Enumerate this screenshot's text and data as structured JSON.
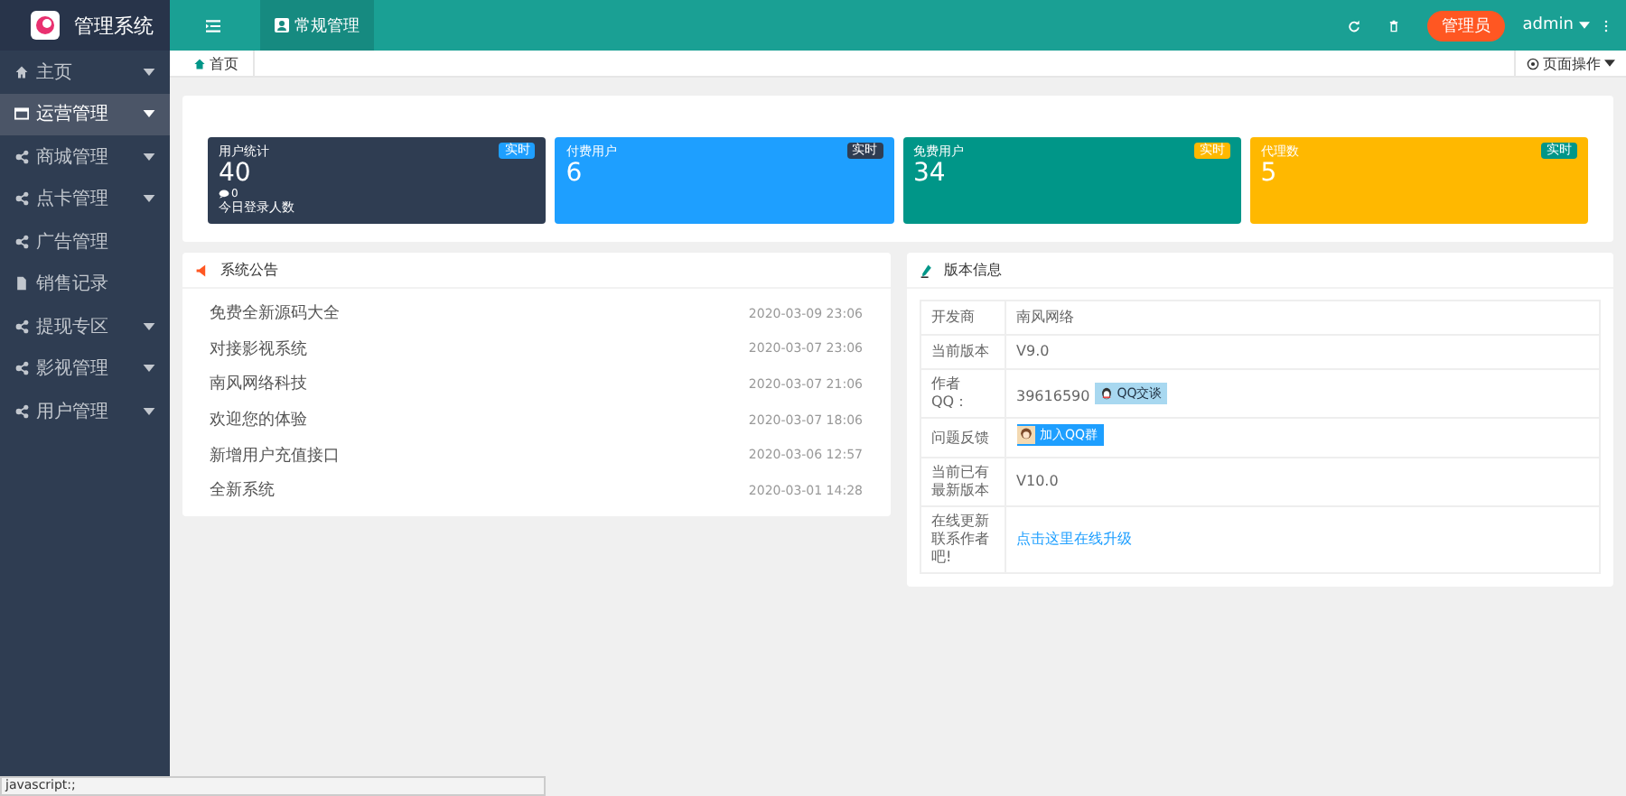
{
  "logo": {
    "title": "管理系统"
  },
  "header": {
    "tabs": [
      {
        "label": "常规管理",
        "selected": true
      }
    ],
    "role_button": "管理员",
    "user": "admin"
  },
  "sidebar": {
    "items": [
      {
        "label": "主页",
        "selected": false,
        "expandable": true
      },
      {
        "label": "运营管理",
        "selected": true,
        "expandable": true
      },
      {
        "label": "商城管理",
        "selected": false,
        "expandable": true
      },
      {
        "label": "点卡管理",
        "selected": false,
        "expandable": true
      },
      {
        "label": "广告管理",
        "selected": false,
        "expandable": false
      },
      {
        "label": "销售记录",
        "selected": false,
        "expandable": false
      },
      {
        "label": "提现专区",
        "selected": false,
        "expandable": true
      },
      {
        "label": "影视管理",
        "selected": false,
        "expandable": true
      },
      {
        "label": "用户管理",
        "selected": false,
        "expandable": true
      }
    ]
  },
  "breadcrumb": {
    "tabs": [
      {
        "label": "首页",
        "selected": true
      }
    ],
    "page_actions": "页面操作"
  },
  "stats": [
    {
      "title": "用户统计",
      "value": "40",
      "badge": "实时",
      "color": "#2f3d52",
      "comments": "0",
      "note": "今日登录人数"
    },
    {
      "title": "付费用户",
      "value": "6",
      "badge": "实时",
      "color": "#1e9fff"
    },
    {
      "title": "免费用户",
      "value": "34",
      "badge": "实时",
      "color": "#009688"
    },
    {
      "title": "代理数",
      "value": "5",
      "badge": "实时",
      "color": "#ffb800"
    }
  ],
  "notices": {
    "title": "系统公告",
    "items": [
      {
        "text": "免费全新源码大全",
        "time": "2020-03-09 23:06"
      },
      {
        "text": "对接影视系统",
        "time": "2020-03-07 23:06"
      },
      {
        "text": "南风网络科技",
        "time": "2020-03-07 21:06"
      },
      {
        "text": "欢迎您的体验",
        "time": "2020-03-07 18:06"
      },
      {
        "text": "新增用户充值接口",
        "time": "2020-03-06 12:57"
      },
      {
        "text": "全新系统",
        "time": "2020-03-01 14:28"
      }
    ]
  },
  "version": {
    "title": "版本信息",
    "rows": [
      {
        "label": "开发商",
        "kind": "text",
        "value": "南风网络"
      },
      {
        "label": "当前版本",
        "kind": "text",
        "value": "V9.0"
      },
      {
        "label": "作者QQ：",
        "kind": "qq",
        "value": "39616590",
        "badge": "QQ交谈"
      },
      {
        "label": "问题反馈",
        "kind": "group",
        "badge": "加入QQ群"
      },
      {
        "label": "当前已有最新版本",
        "kind": "text",
        "value": "V10.0"
      },
      {
        "label": "在线更新联系作者吧!",
        "kind": "link",
        "value": "点击这里在线升级"
      }
    ]
  },
  "status_bar": "javascript:;"
}
